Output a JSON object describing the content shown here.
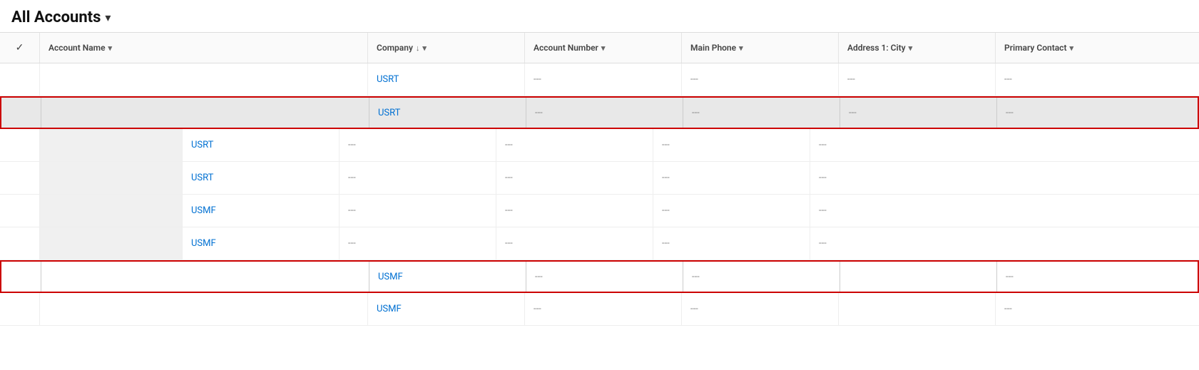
{
  "header": {
    "title": "All Accounts",
    "chevron": "▾"
  },
  "columns": {
    "check": "✓",
    "account_name": "Account Name",
    "company": "Company",
    "account_number": "Account Number",
    "main_phone": "Main Phone",
    "address_city": "Address 1: City",
    "primary_contact": "Primary Contact"
  },
  "rows": [
    {
      "id": 1,
      "company": "USRT",
      "account_number": "---",
      "main_phone": "---",
      "address_city": "---",
      "primary_contact": "---",
      "highlighted": false,
      "red_border": false,
      "blurred_left": false
    },
    {
      "id": 2,
      "company": "USRT",
      "account_number": "---",
      "main_phone": "---",
      "address_city": "---",
      "primary_contact": "---",
      "highlighted": true,
      "red_border": true,
      "blurred_left": false
    },
    {
      "id": 3,
      "company": "USRT",
      "account_number": "---",
      "main_phone": "---",
      "address_city": "---",
      "primary_contact": "---",
      "highlighted": false,
      "red_border": false,
      "blurred_left": true
    },
    {
      "id": 4,
      "company": "USRT",
      "account_number": "---",
      "main_phone": "---",
      "address_city": "---",
      "primary_contact": "---",
      "highlighted": false,
      "red_border": false,
      "blurred_left": true
    },
    {
      "id": 5,
      "company": "USMF",
      "account_number": "---",
      "main_phone": "---",
      "address_city": "---",
      "primary_contact": "---",
      "highlighted": false,
      "red_border": false,
      "blurred_left": true
    },
    {
      "id": 6,
      "company": "USMF",
      "account_number": "---",
      "main_phone": "---",
      "address_city": "---",
      "primary_contact": "---",
      "highlighted": false,
      "red_border": false,
      "blurred_left": true
    },
    {
      "id": 7,
      "company": "USMF",
      "account_number": "---",
      "main_phone": "---",
      "address_city": "---",
      "primary_contact": "---",
      "highlighted": false,
      "red_border": true,
      "blurred_left": false
    },
    {
      "id": 8,
      "company": "USMF",
      "account_number": "---",
      "main_phone": "---",
      "address_city": "---",
      "primary_contact": "---",
      "highlighted": false,
      "red_border": false,
      "blurred_left": false
    }
  ]
}
